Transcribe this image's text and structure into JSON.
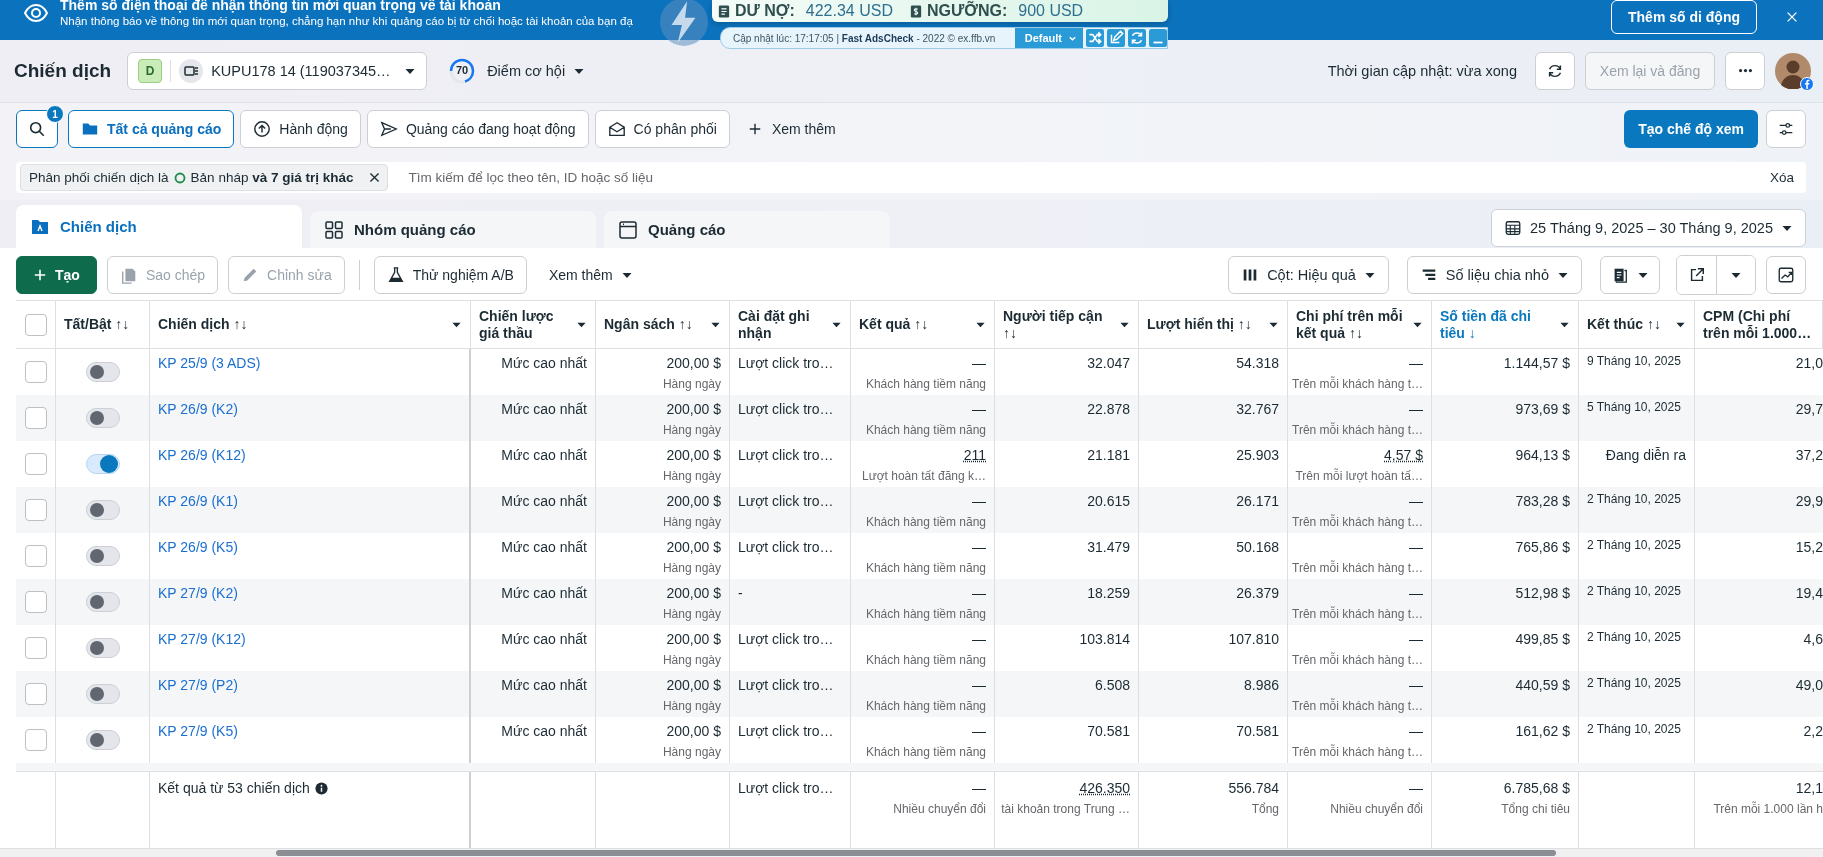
{
  "banner": {
    "title": "Thêm số điện thoại để nhận thông tin mới quan trọng về tài khoản",
    "text": "Nhận thông báo về thông tin mới quan trọng, chẳng hạn như khi quảng cáo bị từ chối hoặc tài khoản của bạn đạ",
    "button": "Thêm số di động"
  },
  "extension": {
    "debt_label": "DƯ NỢ:",
    "debt": "422.34 USD",
    "limit_label": "NGƯỠNG:",
    "limit": "900 USD",
    "updated": "Cập nhật lúc: 17:17:05 | **Fast AdsCheck** - 2022 © ex.ffb.vn",
    "profile": "Default"
  },
  "header": {
    "title": "Chiến dịch",
    "account_badge": "D",
    "account": "KUPU178 14 (119037345…",
    "score": "70",
    "score_label": "Điểm cơ hội",
    "updated": "Thời gian cập nhật: vừa xong",
    "review_button": {
      "label": "Xem lại và đăng",
      "disabled": true
    }
  },
  "views": {
    "filter_count": "1",
    "items": [
      {
        "label": "Tất cả quảng cáo",
        "kind": "folder",
        "selected": true
      },
      {
        "label": "Hành động",
        "kind": "action",
        "selected": false
      },
      {
        "label": "Quảng cáo đang hoạt động",
        "kind": "send",
        "selected": false
      },
      {
        "label": "Có phân phối",
        "kind": "mail",
        "selected": false
      }
    ],
    "more": "Xem thêm",
    "create_view": "Tạo chế độ xem"
  },
  "filter": {
    "label": "Phân phối chiến dịch là",
    "value": "Bản nháp **và 7 giá trị khác**",
    "placeholder": "Tìm kiếm để lọc theo tên, ID hoặc số liệu",
    "clear": "Xóa"
  },
  "level_tabs": [
    {
      "label": "Chiến dịch",
      "kind": "campaign",
      "selected": true
    },
    {
      "label": "Nhóm quảng cáo",
      "kind": "adset",
      "selected": false
    },
    {
      "label": "Quảng cáo",
      "kind": "ad",
      "selected": false
    }
  ],
  "date_range": "25 Tháng 9, 2025 – 30 Tháng 9, 2025",
  "actions": [
    {
      "label": "Tạo",
      "kind": "create",
      "disabled": false
    },
    {
      "label": "Sao chép",
      "kind": "copy",
      "disabled": true
    },
    {
      "label": "Chỉnh sửa",
      "kind": "edit",
      "disabled": true
    },
    {
      "label": "Thử nghiệm A/B",
      "kind": "test",
      "disabled": false
    },
    {
      "label": "Xem thêm",
      "kind": "more",
      "disabled": false
    }
  ],
  "columns_button": "Cột: Hiệu quả",
  "breakdown_button": "Số liệu chia nhỏ",
  "table": {
    "select_all": {
      "checked": false
    },
    "columns": [
      {
        "label": "Tất/Bật ↑↓",
        "sorted": false,
        "menu": false
      },
      {
        "label": "Chiến dịch ↑↓",
        "sorted": false,
        "menu": true
      },
      {
        "label": "Chiến lược giá thầu",
        "sorted": false,
        "menu": true
      },
      {
        "label": "Ngân sách ↑↓",
        "sorted": false,
        "menu": true
      },
      {
        "label": "Cài đặt ghi nhận",
        "sorted": false,
        "menu": true
      },
      {
        "label": "Kết quả ↑↓",
        "sorted": false,
        "menu": true
      },
      {
        "label": "Người tiếp cận ↑↓",
        "sorted": false,
        "menu": true
      },
      {
        "label": "Lượt hiển thị ↑↓",
        "sorted": false,
        "menu": true
      },
      {
        "label": "Chi phí trên mỗi kết quả ↑↓",
        "sorted": false,
        "menu": true
      },
      {
        "label": "Số tiền đã chi tiêu ↓",
        "sorted": true,
        "menu": true
      },
      {
        "label": "Kết thúc ↑↓",
        "sorted": false,
        "menu": true
      },
      {
        "label": "CPM (Chi phí trên mỗi 1.000…",
        "sorted": false,
        "menu": false
      }
    ],
    "rows": [
      {
        "checked": false,
        "on": false,
        "name": "KP 25/9 (3 ADS)",
        "bid": "Mức cao nhất",
        "budget": "200,00 $",
        "budget_note": "Hàng ngày",
        "attribution": "Lượt click tro…",
        "result": {
          "text": "—",
          "note": "Khách hàng tiềm năng",
          "dotted": false
        },
        "reach": "32.047",
        "impressions": "54.318",
        "cost": {
          "text": "—",
          "note": "Trên mỗi khách hàng t…",
          "dotted": false
        },
        "spent": "1.144,57 $",
        "end": {
          "text": "9 Tháng 10, 2025",
          "kind": "date"
        },
        "cpm": "21,0"
      },
      {
        "checked": false,
        "on": false,
        "name": "KP 26/9 (K2)",
        "bid": "Mức cao nhất",
        "budget": "200,00 $",
        "budget_note": "Hàng ngày",
        "attribution": "Lượt click tro…",
        "result": {
          "text": "—",
          "note": "Khách hàng tiềm năng",
          "dotted": false
        },
        "reach": "22.878",
        "impressions": "32.767",
        "cost": {
          "text": "—",
          "note": "Trên mỗi khách hàng t…",
          "dotted": false
        },
        "spent": "973,69 $",
        "end": {
          "text": "5 Tháng 10, 2025",
          "kind": "date"
        },
        "cpm": "29,7"
      },
      {
        "checked": false,
        "on": true,
        "name": "KP 26/9 (K12)",
        "bid": "Mức cao nhất",
        "budget": "200,00 $",
        "budget_note": "Hàng ngày",
        "attribution": "Lượt click tro…",
        "result": {
          "text": "211",
          "note": "Lượt hoàn tất đăng k…",
          "dotted": true
        },
        "reach": "21.181",
        "impressions": "25.903",
        "cost": {
          "text": "4,57 $",
          "note": "Trên mỗi lượt hoàn tấ…",
          "dotted": true
        },
        "spent": "964,13 $",
        "end": {
          "text": "Đang diễn ra",
          "kind": "status"
        },
        "cpm": "37,2"
      },
      {
        "checked": false,
        "on": false,
        "name": "KP 26/9 (K1)",
        "bid": "Mức cao nhất",
        "budget": "200,00 $",
        "budget_note": "Hàng ngày",
        "attribution": "Lượt click tro…",
        "result": {
          "text": "—",
          "note": "Khách hàng tiềm năng",
          "dotted": false
        },
        "reach": "20.615",
        "impressions": "26.171",
        "cost": {
          "text": "—",
          "note": "Trên mỗi khách hàng t…",
          "dotted": false
        },
        "spent": "783,28 $",
        "end": {
          "text": "2 Tháng 10, 2025",
          "kind": "date"
        },
        "cpm": "29,9"
      },
      {
        "checked": false,
        "on": false,
        "name": "KP 26/9 (K5)",
        "bid": "Mức cao nhất",
        "budget": "200,00 $",
        "budget_note": "Hàng ngày",
        "attribution": "Lượt click tro…",
        "result": {
          "text": "—",
          "note": "Khách hàng tiềm năng",
          "dotted": false
        },
        "reach": "31.479",
        "impressions": "50.168",
        "cost": {
          "text": "—",
          "note": "Trên mỗi khách hàng t…",
          "dotted": false
        },
        "spent": "765,86 $",
        "end": {
          "text": "2 Tháng 10, 2025",
          "kind": "date"
        },
        "cpm": "15,2"
      },
      {
        "checked": false,
        "on": false,
        "name": "KP 27/9 (K2)",
        "bid": "Mức cao nhất",
        "budget": "200,00 $",
        "budget_note": "Hàng ngày",
        "attribution": "-",
        "result": {
          "text": "—",
          "note": "Khách hàng tiềm năng",
          "dotted": false
        },
        "reach": "18.259",
        "impressions": "26.379",
        "cost": {
          "text": "—",
          "note": "Trên mỗi khách hàng t…",
          "dotted": false
        },
        "spent": "512,98 $",
        "end": {
          "text": "2 Tháng 10, 2025",
          "kind": "date"
        },
        "cpm": "19,4"
      },
      {
        "checked": false,
        "on": false,
        "name": "KP 27/9 (K12)",
        "bid": "Mức cao nhất",
        "budget": "200,00 $",
        "budget_note": "Hàng ngày",
        "attribution": "Lượt click tro…",
        "result": {
          "text": "—",
          "note": "Khách hàng tiềm năng",
          "dotted": false
        },
        "reach": "103.814",
        "impressions": "107.810",
        "cost": {
          "text": "—",
          "note": "Trên mỗi khách hàng t…",
          "dotted": false
        },
        "spent": "499,85 $",
        "end": {
          "text": "2 Tháng 10, 2025",
          "kind": "date"
        },
        "cpm": "4,6"
      },
      {
        "checked": false,
        "on": false,
        "name": "KP 27/9 (P2)",
        "bid": "Mức cao nhất",
        "budget": "200,00 $",
        "budget_note": "Hàng ngày",
        "attribution": "Lượt click tro…",
        "result": {
          "text": "—",
          "note": "Khách hàng tiềm năng",
          "dotted": false
        },
        "reach": "6.508",
        "impressions": "8.986",
        "cost": {
          "text": "—",
          "note": "Trên mỗi khách hàng t…",
          "dotted": false
        },
        "spent": "440,59 $",
        "end": {
          "text": "2 Tháng 10, 2025",
          "kind": "date"
        },
        "cpm": "49,0"
      },
      {
        "checked": false,
        "on": false,
        "name": "KP 27/9 (K5)",
        "bid": "Mức cao nhất",
        "budget": "200,00 $",
        "budget_note": "Hàng ngày",
        "attribution": "Lượt click tro…",
        "result": {
          "text": "—",
          "note": "Khách hàng tiềm năng",
          "dotted": false
        },
        "reach": "70.581",
        "impressions": "70.581",
        "cost": {
          "text": "—",
          "note": "Trên mỗi khách hàng t…",
          "dotted": false
        },
        "spent": "161,62 $",
        "end": {
          "text": "2 Tháng 10, 2025",
          "kind": "date"
        },
        "cpm": "2,2"
      }
    ],
    "footer": {
      "label": "Kết quả từ 53 chiến dịch",
      "attribution": "Lượt click tro…",
      "result": {
        "text": "—",
        "note": "Nhiều chuyển đổi",
        "dotted": false
      },
      "reach": {
        "text": "426.350",
        "note": "tài khoản trong Trung …",
        "dotted": true
      },
      "impressions": {
        "text": "556.784",
        "note": "Tổng",
        "dotted": false
      },
      "cost": {
        "text": "—",
        "note": "Nhiều chuyển đổi",
        "dotted": false
      },
      "spent": {
        "text": "6.785,68 $",
        "note": "Tổng chi tiêu",
        "dotted": false
      },
      "cpm": {
        "text": "12,1",
        "note": "Trên mỗi 1.000 lần h",
        "dotted": false
      }
    }
  }
}
